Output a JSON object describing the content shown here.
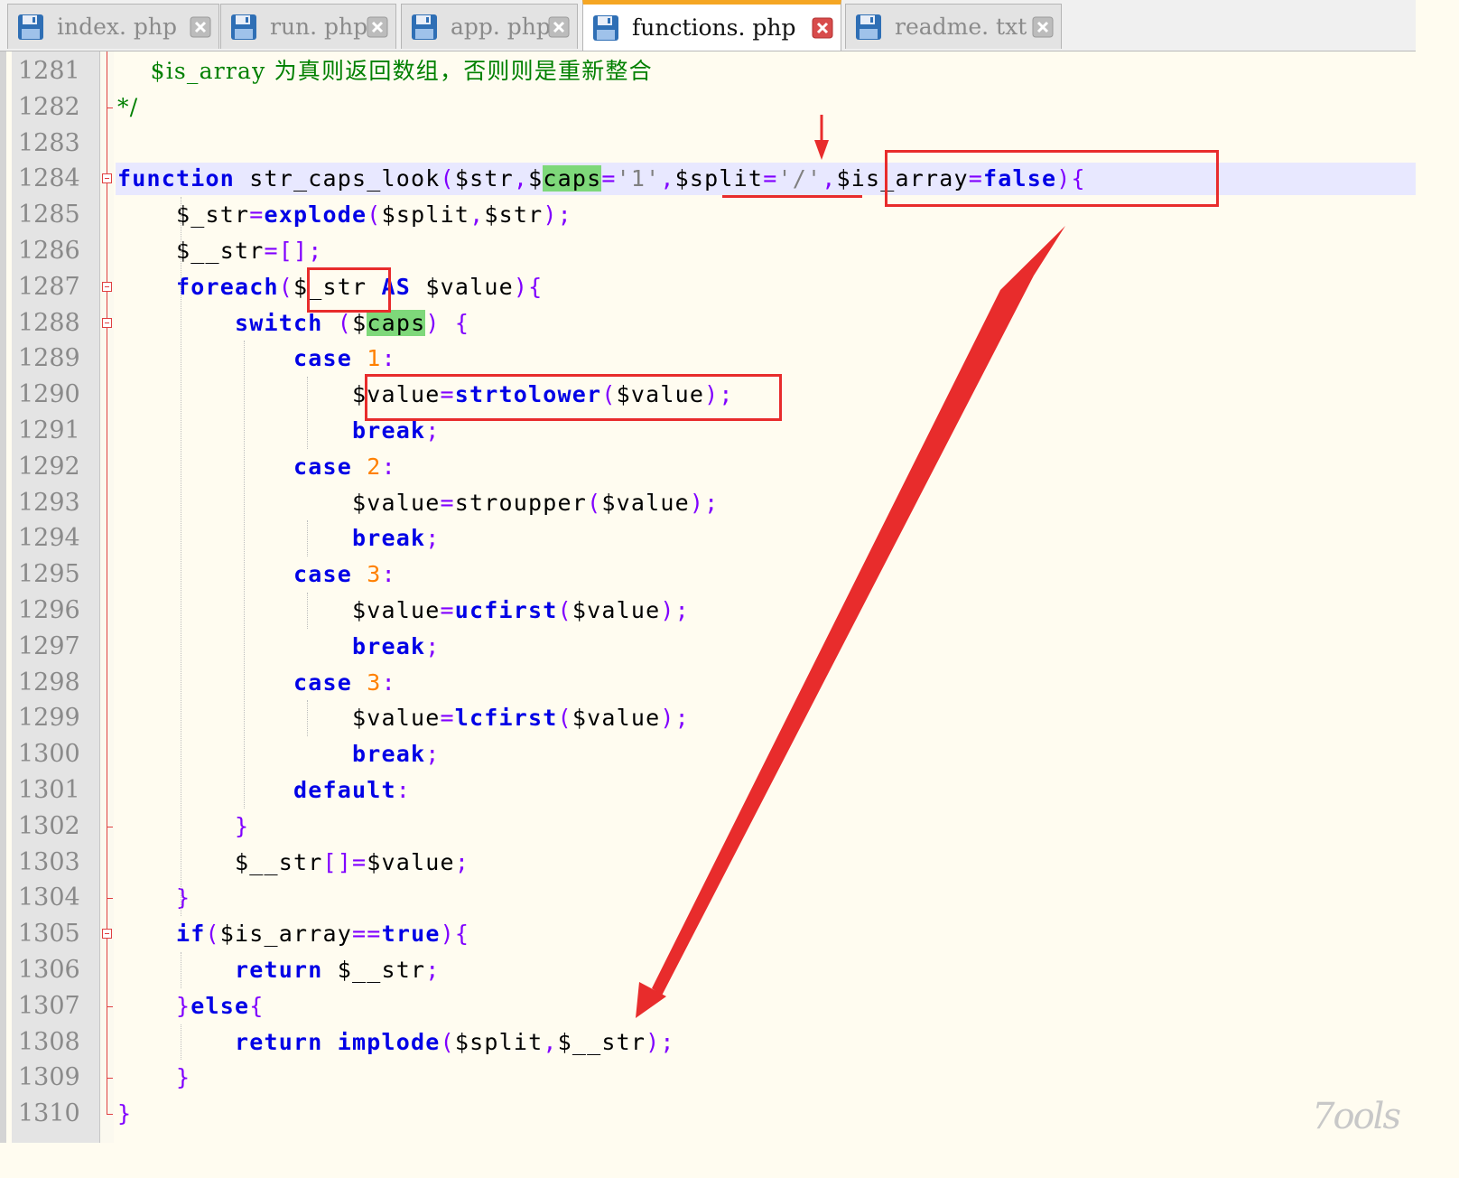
{
  "tabs": [
    {
      "label": "index. php",
      "active": false
    },
    {
      "label": "run. php",
      "active": false
    },
    {
      "label": "app. php",
      "active": false
    },
    {
      "label": "functions. php",
      "active": true
    },
    {
      "label": "readme. txt",
      "active": false
    }
  ],
  "editor": {
    "current_line": 1284,
    "lines": [
      {
        "n": "1281",
        "tokens": [
          [
            "cmt",
            "    $is_array 为真则返回数组，否则则是重新整合"
          ]
        ]
      },
      {
        "n": "1282",
        "tokens": [
          [
            "cmt",
            "*/"
          ]
        ]
      },
      {
        "n": "1283",
        "tokens": []
      },
      {
        "n": "1284",
        "tokens": [
          [
            "kw",
            "function"
          ],
          [
            "var",
            " str_caps_look"
          ],
          [
            "op",
            "("
          ],
          [
            "var",
            "$str"
          ],
          [
            "op",
            ","
          ],
          [
            "var",
            "$"
          ],
          [
            "hl",
            "caps"
          ],
          [
            "op",
            "="
          ],
          [
            "str",
            "'1'"
          ],
          [
            "op",
            ","
          ],
          [
            "var",
            "$split"
          ],
          [
            "op",
            "="
          ],
          [
            "str",
            "'/'"
          ],
          [
            "op",
            ","
          ],
          [
            "var",
            "$is_array"
          ],
          [
            "op",
            "="
          ],
          [
            "kw",
            "false"
          ],
          [
            "op",
            ")"
          ],
          [
            "op",
            "{"
          ]
        ]
      },
      {
        "n": "1285",
        "tokens": [
          [
            "var",
            "    $_str"
          ],
          [
            "op",
            "="
          ],
          [
            "fn",
            "explode"
          ],
          [
            "op",
            "("
          ],
          [
            "var",
            "$split"
          ],
          [
            "op",
            ","
          ],
          [
            "var",
            "$str"
          ],
          [
            "op",
            ")"
          ],
          [
            "op",
            ";"
          ]
        ]
      },
      {
        "n": "1286",
        "tokens": [
          [
            "var",
            "    $__str"
          ],
          [
            "op",
            "=[]"
          ],
          [
            "op",
            ";"
          ]
        ]
      },
      {
        "n": "1287",
        "tokens": [
          [
            "kw",
            "    foreach"
          ],
          [
            "op",
            "("
          ],
          [
            "var",
            "$_str "
          ],
          [
            "kw",
            "AS"
          ],
          [
            "var",
            " $value"
          ],
          [
            "op",
            ")"
          ],
          [
            "op",
            "{"
          ]
        ]
      },
      {
        "n": "1288",
        "tokens": [
          [
            "kw",
            "        switch"
          ],
          [
            "var",
            " "
          ],
          [
            "op",
            "("
          ],
          [
            "var",
            "$"
          ],
          [
            "hl",
            "caps"
          ],
          [
            "op",
            ")"
          ],
          [
            "var",
            " "
          ],
          [
            "op",
            "{"
          ]
        ]
      },
      {
        "n": "1289",
        "tokens": [
          [
            "kw",
            "            case"
          ],
          [
            "var",
            " "
          ],
          [
            "num",
            "1"
          ],
          [
            "op",
            ":"
          ]
        ]
      },
      {
        "n": "1290",
        "tokens": [
          [
            "var",
            "                $value"
          ],
          [
            "op",
            "="
          ],
          [
            "fn",
            "strtolower"
          ],
          [
            "op",
            "("
          ],
          [
            "var",
            "$value"
          ],
          [
            "op",
            ")"
          ],
          [
            "op",
            ";"
          ]
        ]
      },
      {
        "n": "1291",
        "tokens": [
          [
            "kw",
            "                break"
          ],
          [
            "op",
            ";"
          ]
        ]
      },
      {
        "n": "1292",
        "tokens": [
          [
            "kw",
            "            case"
          ],
          [
            "var",
            " "
          ],
          [
            "num",
            "2"
          ],
          [
            "op",
            ":"
          ]
        ]
      },
      {
        "n": "1293",
        "tokens": [
          [
            "var",
            "                $value"
          ],
          [
            "op",
            "="
          ],
          [
            "var",
            "stroupper"
          ],
          [
            "op",
            "("
          ],
          [
            "var",
            "$value"
          ],
          [
            "op",
            ")"
          ],
          [
            "op",
            ";"
          ]
        ]
      },
      {
        "n": "1294",
        "tokens": [
          [
            "kw",
            "                break"
          ],
          [
            "op",
            ";"
          ]
        ]
      },
      {
        "n": "1295",
        "tokens": [
          [
            "kw",
            "            case"
          ],
          [
            "var",
            " "
          ],
          [
            "num",
            "3"
          ],
          [
            "op",
            ":"
          ]
        ]
      },
      {
        "n": "1296",
        "tokens": [
          [
            "var",
            "                $value"
          ],
          [
            "op",
            "="
          ],
          [
            "fn",
            "ucfirst"
          ],
          [
            "op",
            "("
          ],
          [
            "var",
            "$value"
          ],
          [
            "op",
            ")"
          ],
          [
            "op",
            ";"
          ]
        ]
      },
      {
        "n": "1297",
        "tokens": [
          [
            "kw",
            "                break"
          ],
          [
            "op",
            ";"
          ]
        ]
      },
      {
        "n": "1298",
        "tokens": [
          [
            "kw",
            "            case"
          ],
          [
            "var",
            " "
          ],
          [
            "num",
            "3"
          ],
          [
            "op",
            ":"
          ]
        ]
      },
      {
        "n": "1299",
        "tokens": [
          [
            "var",
            "                $value"
          ],
          [
            "op",
            "="
          ],
          [
            "fn",
            "lcfirst"
          ],
          [
            "op",
            "("
          ],
          [
            "var",
            "$value"
          ],
          [
            "op",
            ")"
          ],
          [
            "op",
            ";"
          ]
        ]
      },
      {
        "n": "1300",
        "tokens": [
          [
            "kw",
            "                break"
          ],
          [
            "op",
            ";"
          ]
        ]
      },
      {
        "n": "1301",
        "tokens": [
          [
            "kw",
            "            default"
          ],
          [
            "op",
            ":"
          ]
        ]
      },
      {
        "n": "1302",
        "tokens": [
          [
            "op",
            "        }"
          ]
        ]
      },
      {
        "n": "1303",
        "tokens": [
          [
            "var",
            "        $__str"
          ],
          [
            "op",
            "[]="
          ],
          [
            "var",
            "$value"
          ],
          [
            "op",
            ";"
          ]
        ]
      },
      {
        "n": "1304",
        "tokens": [
          [
            "op",
            "    }"
          ]
        ]
      },
      {
        "n": "1305",
        "tokens": [
          [
            "kw",
            "    if"
          ],
          [
            "op",
            "("
          ],
          [
            "var",
            "$is_array"
          ],
          [
            "op",
            "=="
          ],
          [
            "kw",
            "true"
          ],
          [
            "op",
            ")"
          ],
          [
            "op",
            "{"
          ]
        ]
      },
      {
        "n": "1306",
        "tokens": [
          [
            "kw",
            "        return"
          ],
          [
            "var",
            " $__str"
          ],
          [
            "op",
            ";"
          ]
        ]
      },
      {
        "n": "1307",
        "tokens": [
          [
            "op",
            "    }"
          ],
          [
            "kw",
            "else"
          ],
          [
            "op",
            "{"
          ]
        ]
      },
      {
        "n": "1308",
        "tokens": [
          [
            "kw",
            "        return"
          ],
          [
            "var",
            " "
          ],
          [
            "fn",
            "implode"
          ],
          [
            "op",
            "("
          ],
          [
            "var",
            "$split"
          ],
          [
            "op",
            ","
          ],
          [
            "var",
            "$__str"
          ],
          [
            "op",
            ")"
          ],
          [
            "op",
            ";"
          ]
        ]
      },
      {
        "n": "1309",
        "tokens": [
          [
            "op",
            "    }"
          ]
        ]
      },
      {
        "n": "1310",
        "tokens": [
          [
            "op",
            "}"
          ]
        ]
      }
    ]
  },
  "watermark": "7ools",
  "colors": {
    "keyword": "#0000e6",
    "operator": "#8000ff",
    "string": "#808080",
    "number": "#ff8000",
    "comment": "#008000",
    "highlight": "#7ed87a",
    "annotation": "#e82c2c",
    "tab_accent": "#f5a623"
  }
}
